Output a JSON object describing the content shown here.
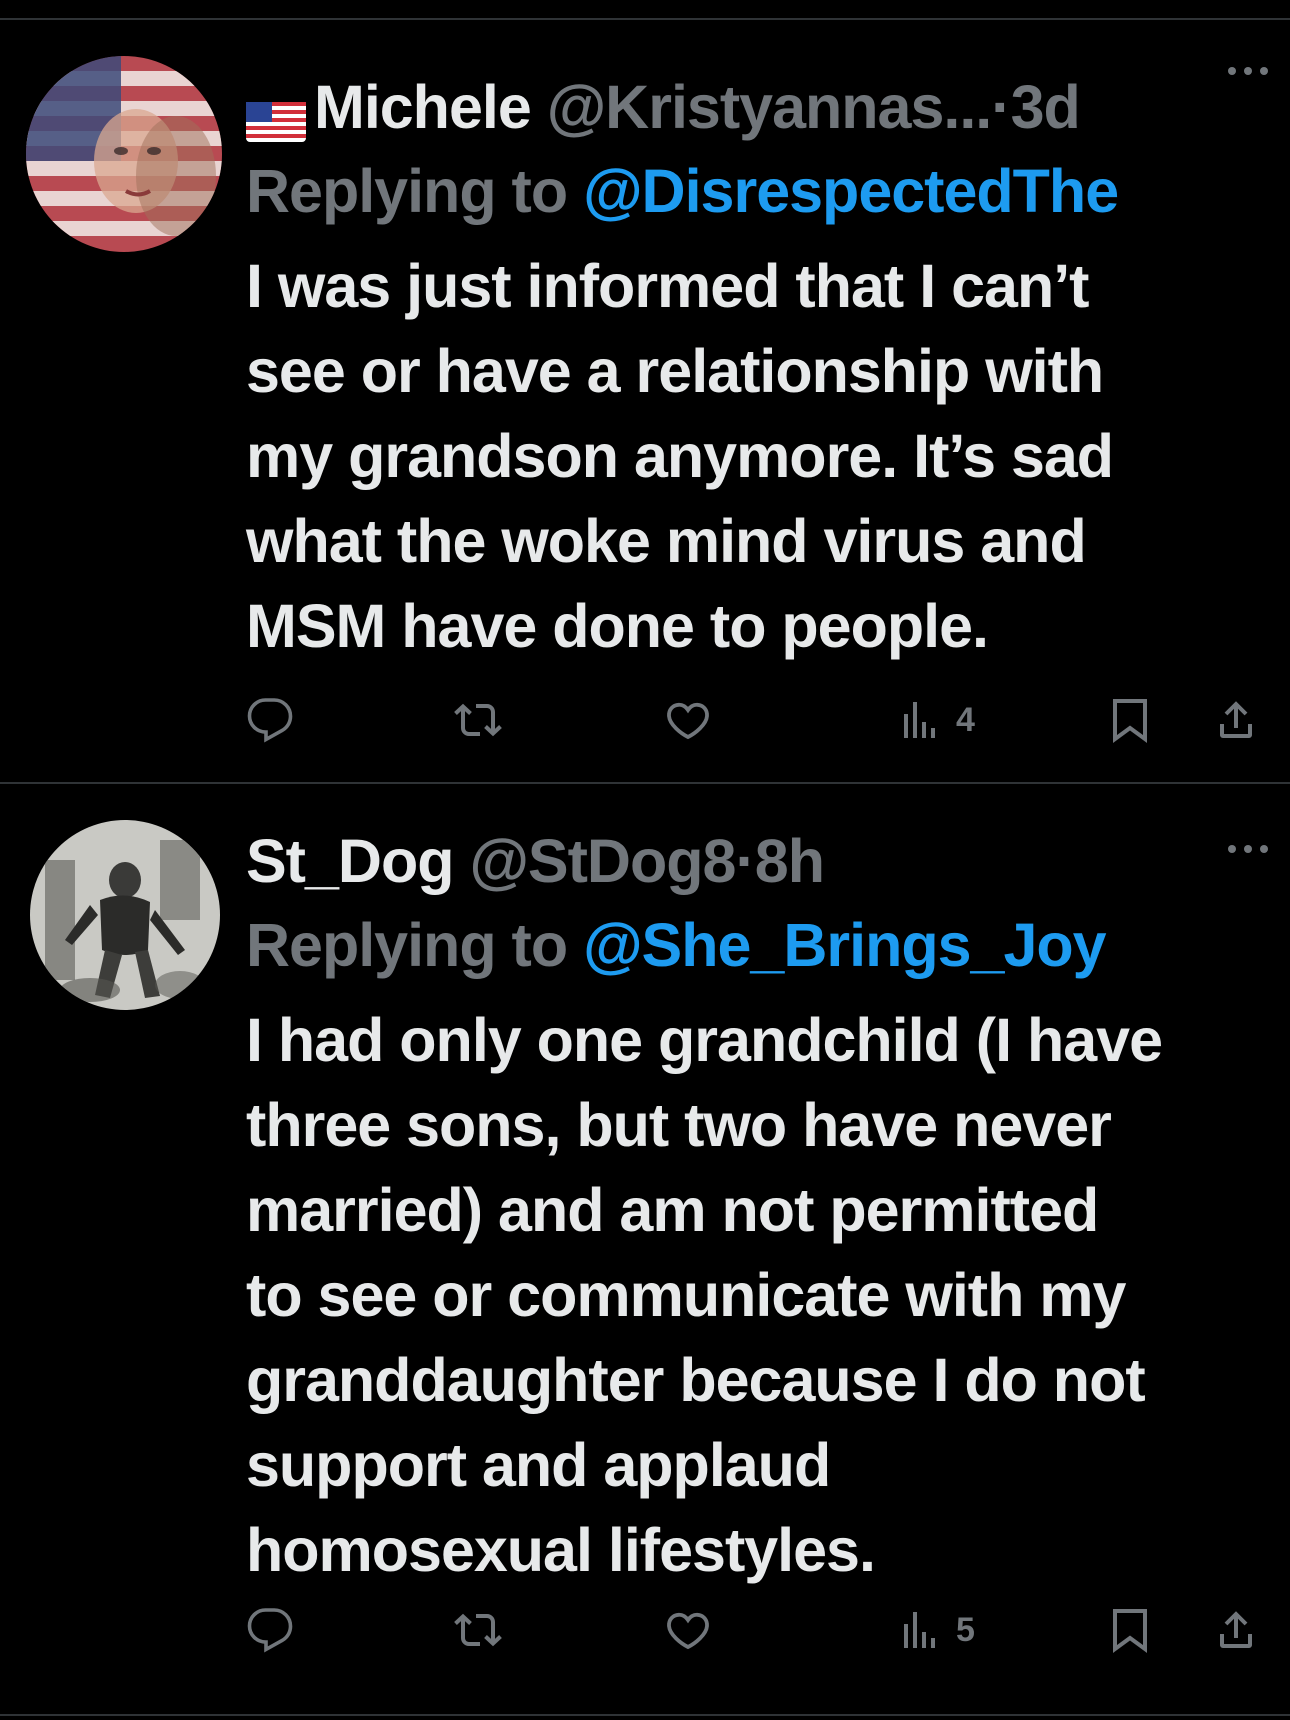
{
  "tweets": [
    {
      "name": "Michele",
      "flag_emoji": "us-flag-icon",
      "handle": "@Kristyannas...",
      "separator": "·",
      "time": "3d",
      "replying_label": "Replying to",
      "replying_to": "@DisrespectedThe",
      "body_lines": [
        "I was just informed that I can’t",
        "see or have a relationship with",
        "my grandson anymore. It’s sad",
        "what the woke mind virus and",
        "MSM have done to people."
      ],
      "views": "4"
    },
    {
      "name": "St_Dog",
      "handle": "@StDog8",
      "separator": "·",
      "time": "8h",
      "replying_label": "Replying to",
      "replying_to": "@She_Brings_Joy",
      "body_lines": [
        "I had only one grandchild (I have",
        "three sons, but two have never",
        "married) and am not permitted",
        "to see or communicate with my",
        "granddaughter because I do not",
        "support and applaud",
        "homosexual lifestyles."
      ],
      "views": "5"
    }
  ],
  "colors": {
    "background": "#000000",
    "text": "#e7e9ea",
    "muted": "#71767b",
    "link": "#1d9bf0",
    "divider": "#2f3336"
  }
}
